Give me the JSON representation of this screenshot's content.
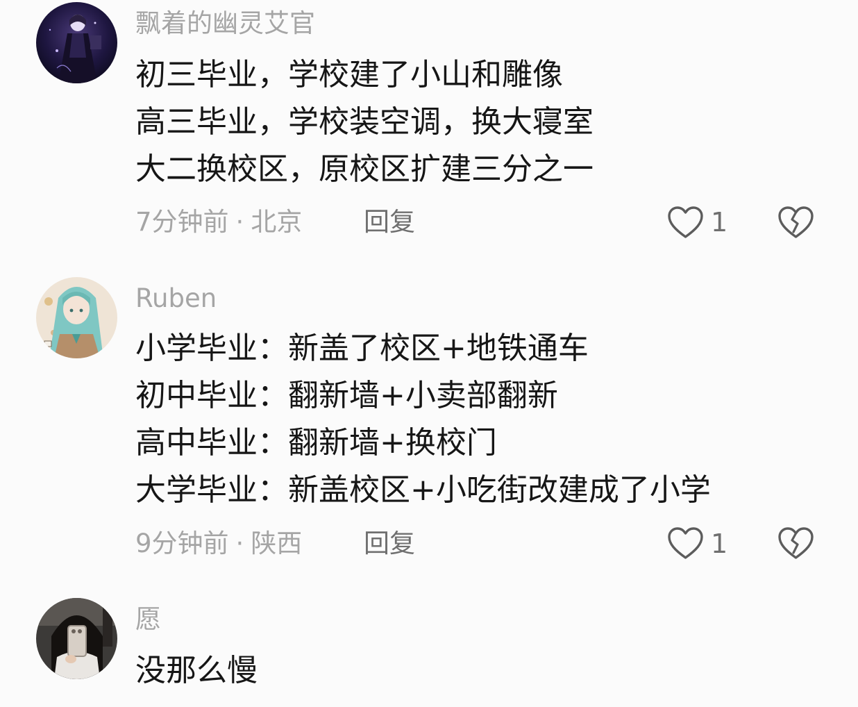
{
  "comments": [
    {
      "username": "飘着的幽灵艾官",
      "avatar_icon": "avatar-dark-anime-character",
      "lines": [
        "初三毕业，学校建了小山和雕像",
        "高三毕业，学校装空调，换大寝室",
        "大二换校区，原校区扩建三分之一"
      ],
      "time": "7分钟前",
      "separator": "·",
      "location": "北京",
      "reply_label": "回复",
      "like_count": "1"
    },
    {
      "username": "Ruben",
      "avatar_icon": "avatar-anime-girl-teal-hair",
      "lines": [
        "小学毕业：新盖了校区+地铁通车",
        "初中毕业：翻新墙+小卖部翻新",
        "高中毕业：翻新墙+换校门",
        "大学毕业：新盖校区+小吃街改建成了小学"
      ],
      "time": "9分钟前",
      "separator": "·",
      "location": "陕西",
      "reply_label": "回复",
      "like_count": "1"
    },
    {
      "username": "愿",
      "avatar_icon": "avatar-person-with-phone",
      "lines": [
        "没那么慢"
      ]
    }
  ],
  "icons": {
    "like": "heart-outline-icon",
    "dislike": "broken-heart-outline-icon"
  },
  "colors": {
    "background": "#fbfbfb",
    "username": "#a5a5a5",
    "content": "#161616",
    "action": "#6f6f6f"
  }
}
